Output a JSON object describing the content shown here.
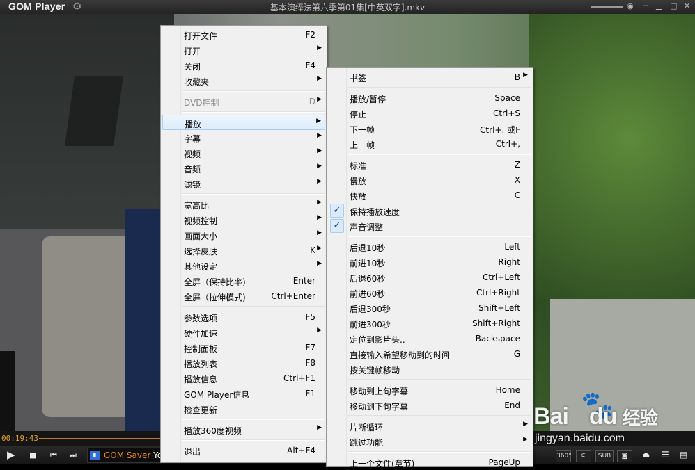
{
  "app": {
    "logo": "GOM Player",
    "title": "基本演绎法第六季第01集[中英双字].mkv"
  },
  "player": {
    "current_time": "00:19:43",
    "ad_text_orange": "GOM Saver",
    "ad_text_white": " Yo",
    "buttons": {
      "360": "360°",
      "sub": "SUB"
    }
  },
  "main_menu": {
    "items": [
      {
        "label": "打开文件",
        "shortcut": "F2"
      },
      {
        "label": "打开",
        "submenu": true
      },
      {
        "label": "关闭",
        "shortcut": "F4"
      },
      {
        "label": "收藏夹",
        "submenu": true
      },
      {
        "sep": true
      },
      {
        "label": "DVD控制",
        "shortcut": "D",
        "submenu": true,
        "disabled": true
      },
      {
        "sep": true
      },
      {
        "label": "播放",
        "submenu": true,
        "highlighted": true
      },
      {
        "label": "字幕",
        "submenu": true
      },
      {
        "label": "视频",
        "submenu": true
      },
      {
        "label": "音频",
        "submenu": true
      },
      {
        "label": "滤镜",
        "submenu": true
      },
      {
        "sep": true
      },
      {
        "label": "宽高比",
        "submenu": true
      },
      {
        "label": "视频控制",
        "submenu": true
      },
      {
        "label": "画面大小",
        "submenu": true
      },
      {
        "label": "选择皮肤",
        "shortcut": "K",
        "submenu": true
      },
      {
        "label": "其他设定",
        "submenu": true
      },
      {
        "label": "全屏（保持比率)",
        "shortcut": "Enter"
      },
      {
        "label": "全屏（拉伸模式)",
        "shortcut": "Ctrl+Enter"
      },
      {
        "sep": true
      },
      {
        "label": "参数选项",
        "shortcut": "F5"
      },
      {
        "label": "硬件加速",
        "submenu": true
      },
      {
        "label": "控制面板",
        "shortcut": "F7"
      },
      {
        "label": "播放列表",
        "shortcut": "F8"
      },
      {
        "label": "播放信息",
        "shortcut": "Ctrl+F1"
      },
      {
        "label": "GOM Player信息",
        "shortcut": "F1"
      },
      {
        "label": "检查更新"
      },
      {
        "sep": true
      },
      {
        "label": "播放360度视频",
        "submenu": true
      },
      {
        "sep": true
      },
      {
        "label": "退出",
        "shortcut": "Alt+F4"
      }
    ]
  },
  "play_submenu": {
    "items": [
      {
        "label": "书签",
        "shortcut": "B",
        "submenu": true
      },
      {
        "sep": true
      },
      {
        "label": "播放/暂停",
        "shortcut": "Space"
      },
      {
        "label": "停止",
        "shortcut": "Ctrl+S"
      },
      {
        "label": "下一帧",
        "shortcut": "Ctrl+. 或F"
      },
      {
        "label": "上一帧",
        "shortcut": "Ctrl+,"
      },
      {
        "sep": true
      },
      {
        "label": "标准",
        "shortcut": "Z"
      },
      {
        "label": "慢放",
        "shortcut": "X"
      },
      {
        "label": "快放",
        "shortcut": "C"
      },
      {
        "label": "保持播放速度",
        "checked": true
      },
      {
        "label": "声音调整",
        "checked": true
      },
      {
        "sep": true
      },
      {
        "label": "后退10秒",
        "shortcut": "Left"
      },
      {
        "label": "前进10秒",
        "shortcut": "Right"
      },
      {
        "label": "后退60秒",
        "shortcut": "Ctrl+Left"
      },
      {
        "label": "前进60秒",
        "shortcut": "Ctrl+Right"
      },
      {
        "label": "后退300秒",
        "shortcut": "Shift+Left"
      },
      {
        "label": "前进300秒",
        "shortcut": "Shift+Right"
      },
      {
        "label": "定位到影片头..",
        "shortcut": "Backspace"
      },
      {
        "label": "直接输入希望移动到的时间",
        "shortcut": "G"
      },
      {
        "label": "按关键帧移动"
      },
      {
        "sep": true
      },
      {
        "label": "移动到上句字幕",
        "shortcut": "Home"
      },
      {
        "label": "移动到下句字幕",
        "shortcut": "End"
      },
      {
        "sep": true
      },
      {
        "label": "片断循环",
        "submenu": true
      },
      {
        "label": "跳过功能",
        "submenu": true
      },
      {
        "sep": true
      },
      {
        "label": "上一个文件(章节)",
        "shortcut": "PageUp"
      }
    ]
  },
  "watermark": {
    "logo_a": "Bai",
    "logo_b": "du",
    "extra": "经验",
    "url": "jingyan.baidu.com"
  },
  "colors": {
    "menu_bg": "#f0f0f0",
    "highlight": "#dcebfc",
    "accent_orange": "#e88a10"
  }
}
